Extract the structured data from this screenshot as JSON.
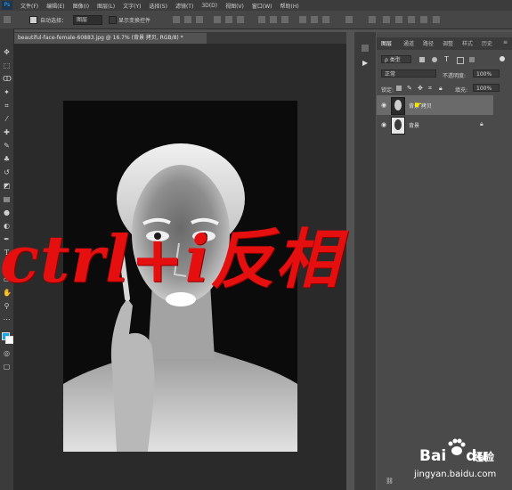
{
  "menu": {
    "items": [
      "文件(F)",
      "编辑(E)",
      "图像(I)",
      "图层(L)",
      "文字(Y)",
      "选择(S)",
      "滤镜(T)",
      "3D(D)",
      "视图(V)",
      "窗口(W)",
      "帮助(H)"
    ]
  },
  "options_bar": {
    "auto_select_label": "自动选择：",
    "auto_select_value": "图层",
    "show_transform_label": "显示变换控件"
  },
  "document_tab": {
    "title": "beautiful-face-female-60883.jpg @ 16.7% (背景 拷贝, RGB/8) *"
  },
  "layers_panel": {
    "tabs": [
      "图层",
      "通道",
      "路径",
      "调整",
      "样式",
      "历史"
    ],
    "filter_label": "ρ 类型",
    "blend_mode": "正常",
    "opacity_label": "不透明度:",
    "opacity_value": "100%",
    "lock_label": "锁定:",
    "fill_label": "填充:",
    "fill_value": "100%",
    "layers": [
      {
        "name": "背景 拷贝",
        "selected": true,
        "visible": true
      },
      {
        "name": "背景",
        "selected": false,
        "visible": true,
        "locked": true
      }
    ]
  },
  "overlay_text": "ctrl+i反相",
  "watermark": {
    "brand": "Bai",
    "brand_suffix": "du",
    "jingyan": "经验",
    "url": "jingyan.baidu.com"
  },
  "colors": {
    "overlay_red": "#e60f0f",
    "canvas_bg": "#0b0b0b",
    "ui_dark": "#3c3c3c"
  }
}
